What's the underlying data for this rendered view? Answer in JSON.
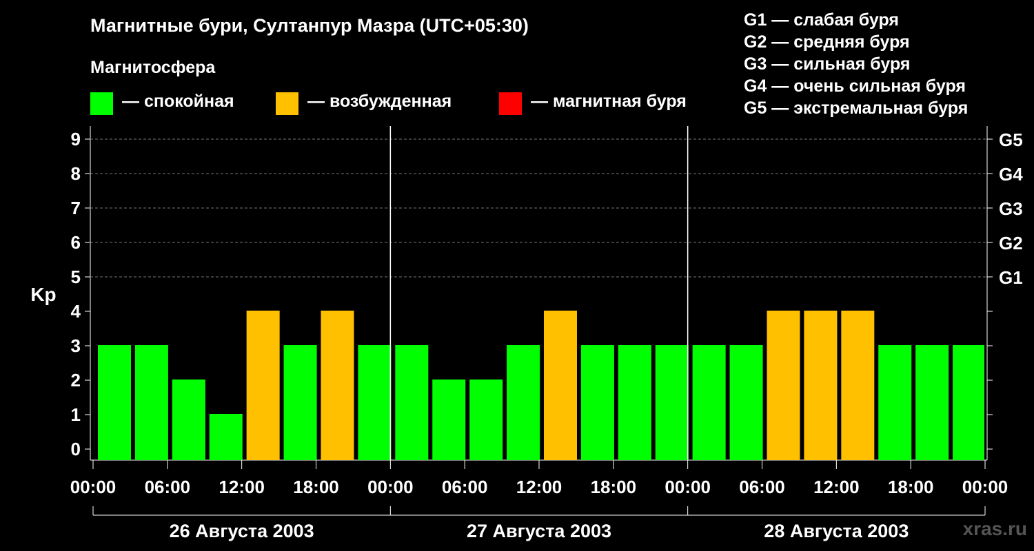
{
  "title": "Магнитные бури, Султанпур Мазра (UTC+05:30)",
  "subtitle": "Магнитосфера",
  "legend": [
    {
      "label": "— спокойная",
      "color": "#00ff00"
    },
    {
      "label": "— возбужденная",
      "color": "#ffc000"
    },
    {
      "label": "— магнитная буря",
      "color": "#ff0000"
    }
  ],
  "g_legend": [
    "G1 — слабая буря",
    "G2 — средняя буря",
    "G3 — сильная буря",
    "G4 — очень сильная буря",
    "G5 — экстремальная буря"
  ],
  "watermark": "xras.ru",
  "chart_data": {
    "type": "bar",
    "ylabel": "Kp",
    "ylim": [
      0,
      9
    ],
    "yticks": [
      "0",
      "1",
      "2",
      "3",
      "4",
      "5",
      "6",
      "7",
      "8",
      "9"
    ],
    "right_ticks": [
      {
        "kp": 5,
        "label": "G1"
      },
      {
        "kp": 6,
        "label": "G2"
      },
      {
        "kp": 7,
        "label": "G3"
      },
      {
        "kp": 8,
        "label": "G4"
      },
      {
        "kp": 9,
        "label": "G5"
      }
    ],
    "xticks": [
      "00:00",
      "06:00",
      "12:00",
      "18:00",
      "00:00",
      "06:00",
      "12:00",
      "18:00",
      "00:00",
      "06:00",
      "12:00",
      "18:00",
      "00:00"
    ],
    "days": [
      "26 Августа 2003",
      "27 Августа 2003",
      "28 Августа 2003"
    ],
    "interval_hours": 3,
    "first_bar_start_hours": -2.5,
    "values": [
      3,
      3,
      3,
      2,
      1,
      4,
      3,
      4,
      3,
      3,
      2,
      2,
      3,
      4,
      3,
      3,
      3,
      3,
      3,
      4,
      4,
      4,
      3,
      3,
      3
    ],
    "color_rule": {
      "quiet_max": 3,
      "active": 4,
      "storm_min": 5
    },
    "colors": {
      "quiet": "#00ff00",
      "active": "#ffc000",
      "storm": "#ff0000"
    },
    "grid": true
  }
}
